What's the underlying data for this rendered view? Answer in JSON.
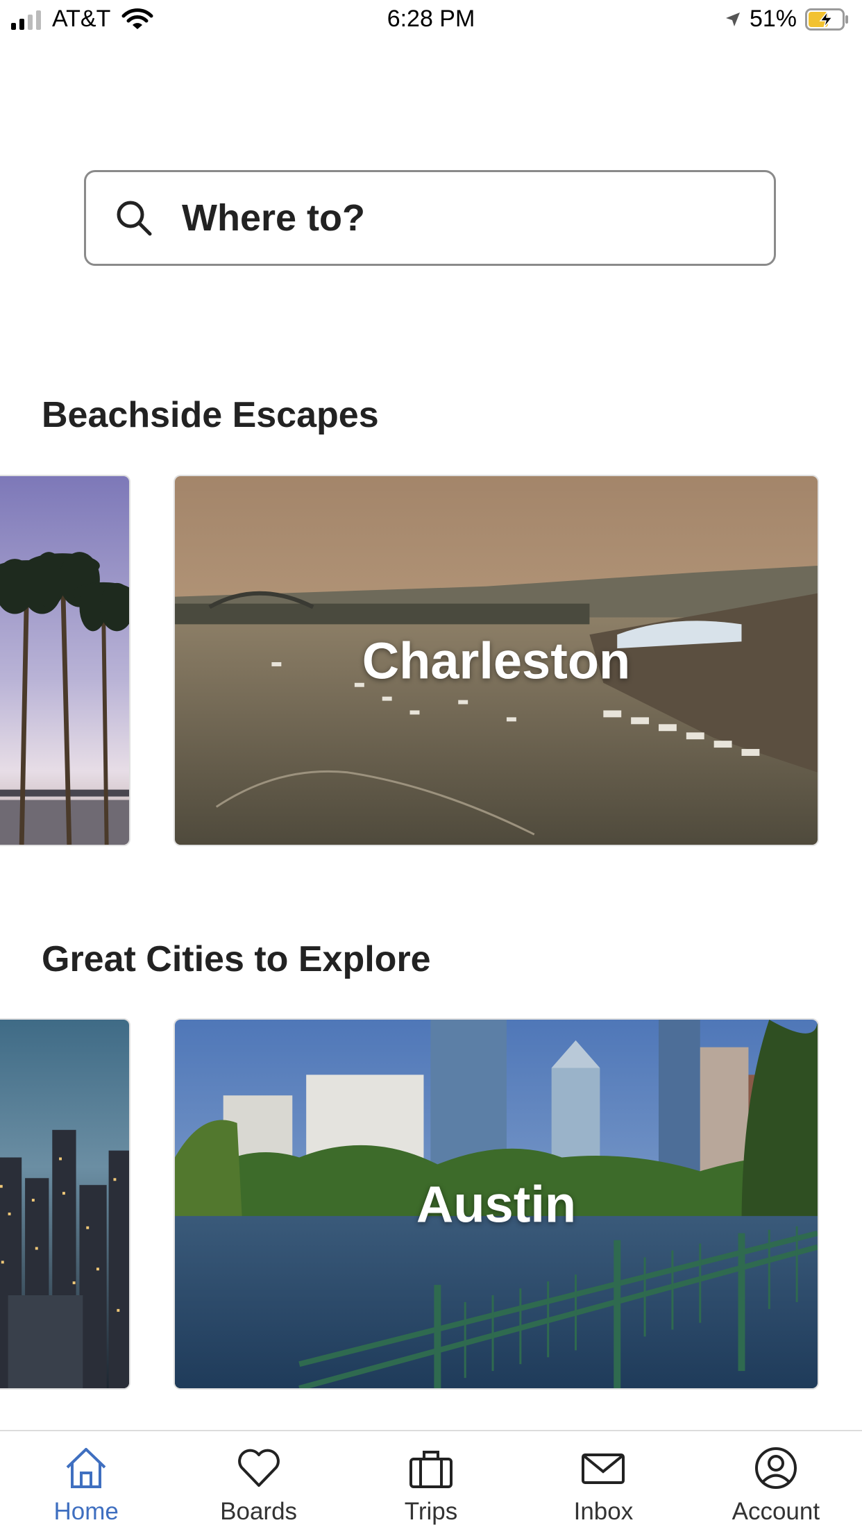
{
  "status_bar": {
    "carrier": "AT&T",
    "time": "6:28 PM",
    "battery": "51%"
  },
  "search": {
    "placeholder": "Where to?"
  },
  "sections": [
    {
      "title": "Beachside Escapes",
      "cards": [
        {
          "label": ""
        },
        {
          "label": "Charleston"
        }
      ]
    },
    {
      "title": "Great Cities to Explore",
      "cards": [
        {
          "label": ""
        },
        {
          "label": "Austin"
        }
      ]
    }
  ],
  "tab_bar": {
    "active_color": "#3f6fc0",
    "tabs": [
      {
        "label": "Home",
        "icon": "home-icon"
      },
      {
        "label": "Boards",
        "icon": "heart-icon"
      },
      {
        "label": "Trips",
        "icon": "suitcase-icon"
      },
      {
        "label": "Inbox",
        "icon": "envelope-icon"
      },
      {
        "label": "Account",
        "icon": "account-icon"
      }
    ]
  }
}
